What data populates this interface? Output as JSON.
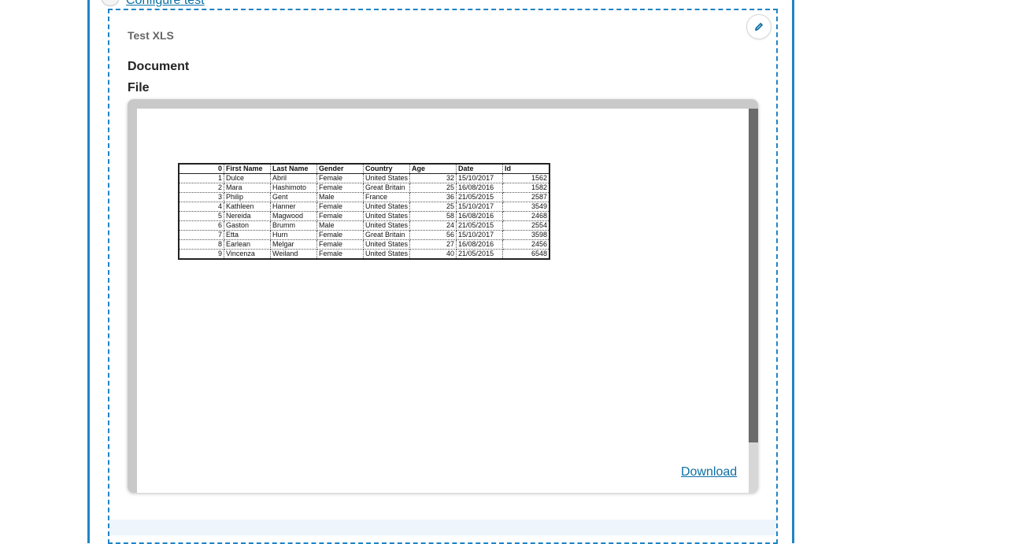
{
  "header": {
    "configure_label": "Configure test"
  },
  "block": {
    "title": "Test XLS",
    "document_label": "Document",
    "file_label": "File"
  },
  "viewer": {
    "download_label": "Download",
    "sheet": {
      "headers": [
        "0",
        "First Name",
        "Last Name",
        "Gender",
        "Country",
        "Age",
        "Date",
        "Id"
      ],
      "rows": [
        [
          "1",
          "Dulce",
          "Abril",
          "Female",
          "United States",
          "32",
          "15/10/2017",
          "1562"
        ],
        [
          "2",
          "Mara",
          "Hashimoto",
          "Female",
          "Great Britain",
          "25",
          "16/08/2016",
          "1582"
        ],
        [
          "3",
          "Philip",
          "Gent",
          "Male",
          "France",
          "36",
          "21/05/2015",
          "2587"
        ],
        [
          "4",
          "Kathleen",
          "Hanner",
          "Female",
          "United States",
          "25",
          "15/10/2017",
          "3549"
        ],
        [
          "5",
          "Nereida",
          "Magwood",
          "Female",
          "United States",
          "58",
          "16/08/2016",
          "2468"
        ],
        [
          "6",
          "Gaston",
          "Brumm",
          "Male",
          "United States",
          "24",
          "21/05/2015",
          "2554"
        ],
        [
          "7",
          "Etta",
          "Hurn",
          "Female",
          "Great Britain",
          "56",
          "15/10/2017",
          "3598"
        ],
        [
          "8",
          "Earlean",
          "Melgar",
          "Female",
          "United States",
          "27",
          "16/08/2016",
          "2456"
        ],
        [
          "9",
          "Vincenza",
          "Weiland",
          "Female",
          "United States",
          "40",
          "21/05/2015",
          "6548"
        ]
      ]
    }
  },
  "icons": {
    "edit": "pencil-icon",
    "configure": "configure-icon"
  },
  "colors": {
    "accent": "#1f84c6",
    "link": "#0b6fa4"
  }
}
